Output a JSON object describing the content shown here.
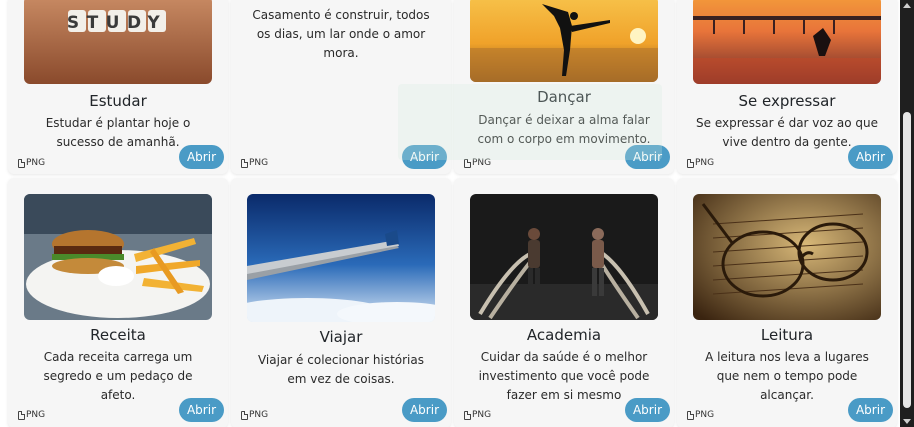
{
  "cards": [
    {
      "title": "Estudar",
      "description": "Estudar é plantar hoje o sucesso de amanhã.",
      "image_text": "STUDY",
      "file_type": "PNG",
      "button": "Abrir"
    },
    {
      "title": "",
      "description": "Casamento é construir, todos os dias, um lar onde o amor mora.",
      "file_type": "PNG",
      "button": "Abrir"
    },
    {
      "title": "Dançar",
      "description": "Dançar é deixar a alma falar com o corpo em movimento.",
      "file_type": "PNG",
      "button": "Abrir"
    },
    {
      "title": "Se expressar",
      "description": "Se expressar é dar voz ao que vive dentro da gente.",
      "file_type": "PNG",
      "button": "Abrir"
    },
    {
      "title": "Receita",
      "description": "Cada receita carrega um segredo e um pedaço de afeto.",
      "file_type": "PNG",
      "button": "Abrir"
    },
    {
      "title": "Viajar",
      "description": "Viajar é colecionar histórias em vez de coisas.",
      "file_type": "PNG",
      "button": "Abrir"
    },
    {
      "title": "Academia",
      "description": "Cuidar da saúde é o melhor investimento que você pode fazer em si mesmo",
      "file_type": "PNG",
      "button": "Abrir"
    },
    {
      "title": "Leitura",
      "description": "A leitura nos leva a lugares que nem o tempo pode alcançar.",
      "file_type": "PNG",
      "button": "Abrir"
    }
  ],
  "colors": {
    "card_bg": "#f6f6f6",
    "button": "#4a9bc6",
    "scrollbar": "#1f1f1f"
  }
}
